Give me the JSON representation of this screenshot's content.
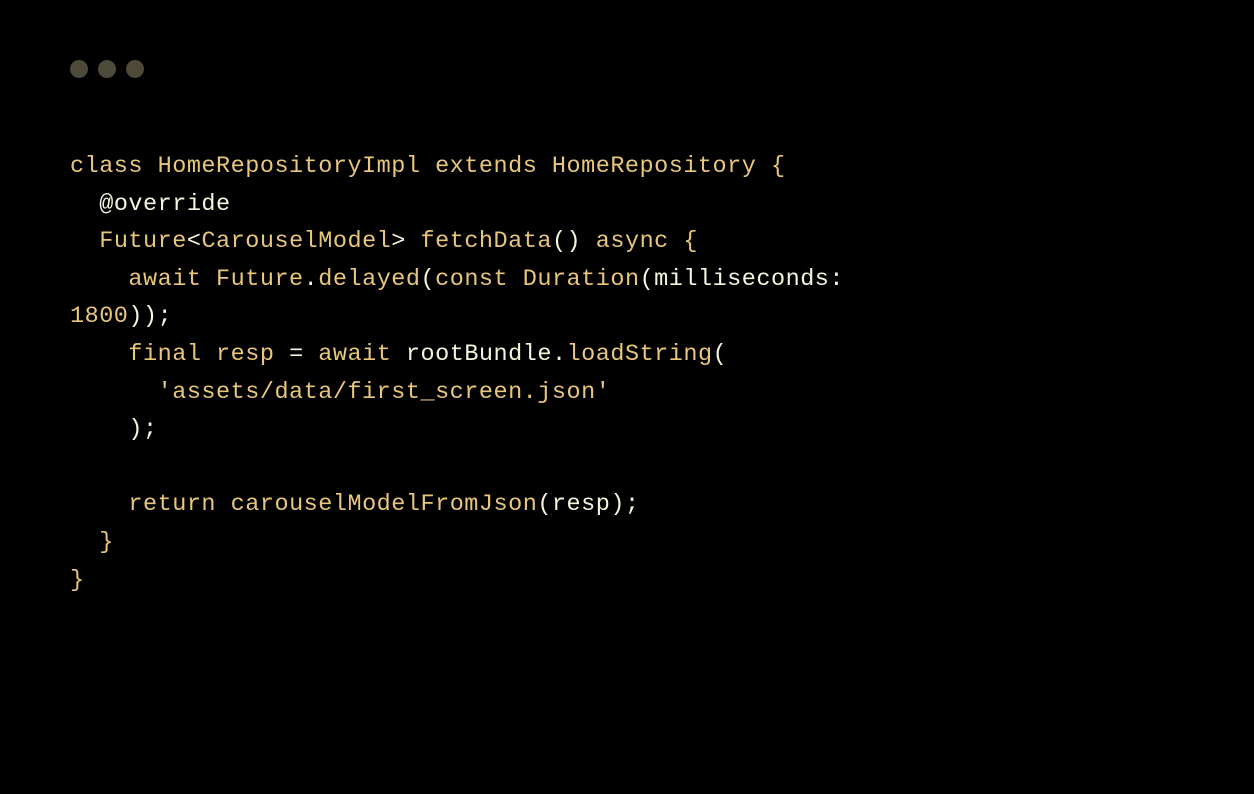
{
  "code": {
    "kw_class": "class",
    "class_name": "HomeRepositoryImpl",
    "kw_extends": "extends",
    "super_class": "HomeRepository",
    "brace_open": "{",
    "annotation": "@override",
    "return_type": "Future",
    "generic_open": "<",
    "generic_type": "CarouselModel",
    "generic_close": ">",
    "method_name": "fetchData",
    "parens_open": "(",
    "parens_close": ")",
    "kw_async": "async",
    "kw_await": "await",
    "future_class": "Future",
    "dot": ".",
    "delayed": "delayed",
    "kw_const": "const",
    "duration_class": "Duration",
    "milliseconds_param": "milliseconds",
    "colon": ":",
    "number": "1800",
    "semi": ";",
    "kw_final": "final",
    "var_resp": "resp",
    "equals": "=",
    "root_bundle": "rootBundle",
    "load_string": "loadString",
    "string_literal": "'assets/data/first_screen.json'",
    "kw_return": "return",
    "carousel_fn": "carouselModelFromJson",
    "brace_close": "}",
    "indent1": "  ",
    "indent2": "    ",
    "indent3": "      ",
    "space": " "
  }
}
